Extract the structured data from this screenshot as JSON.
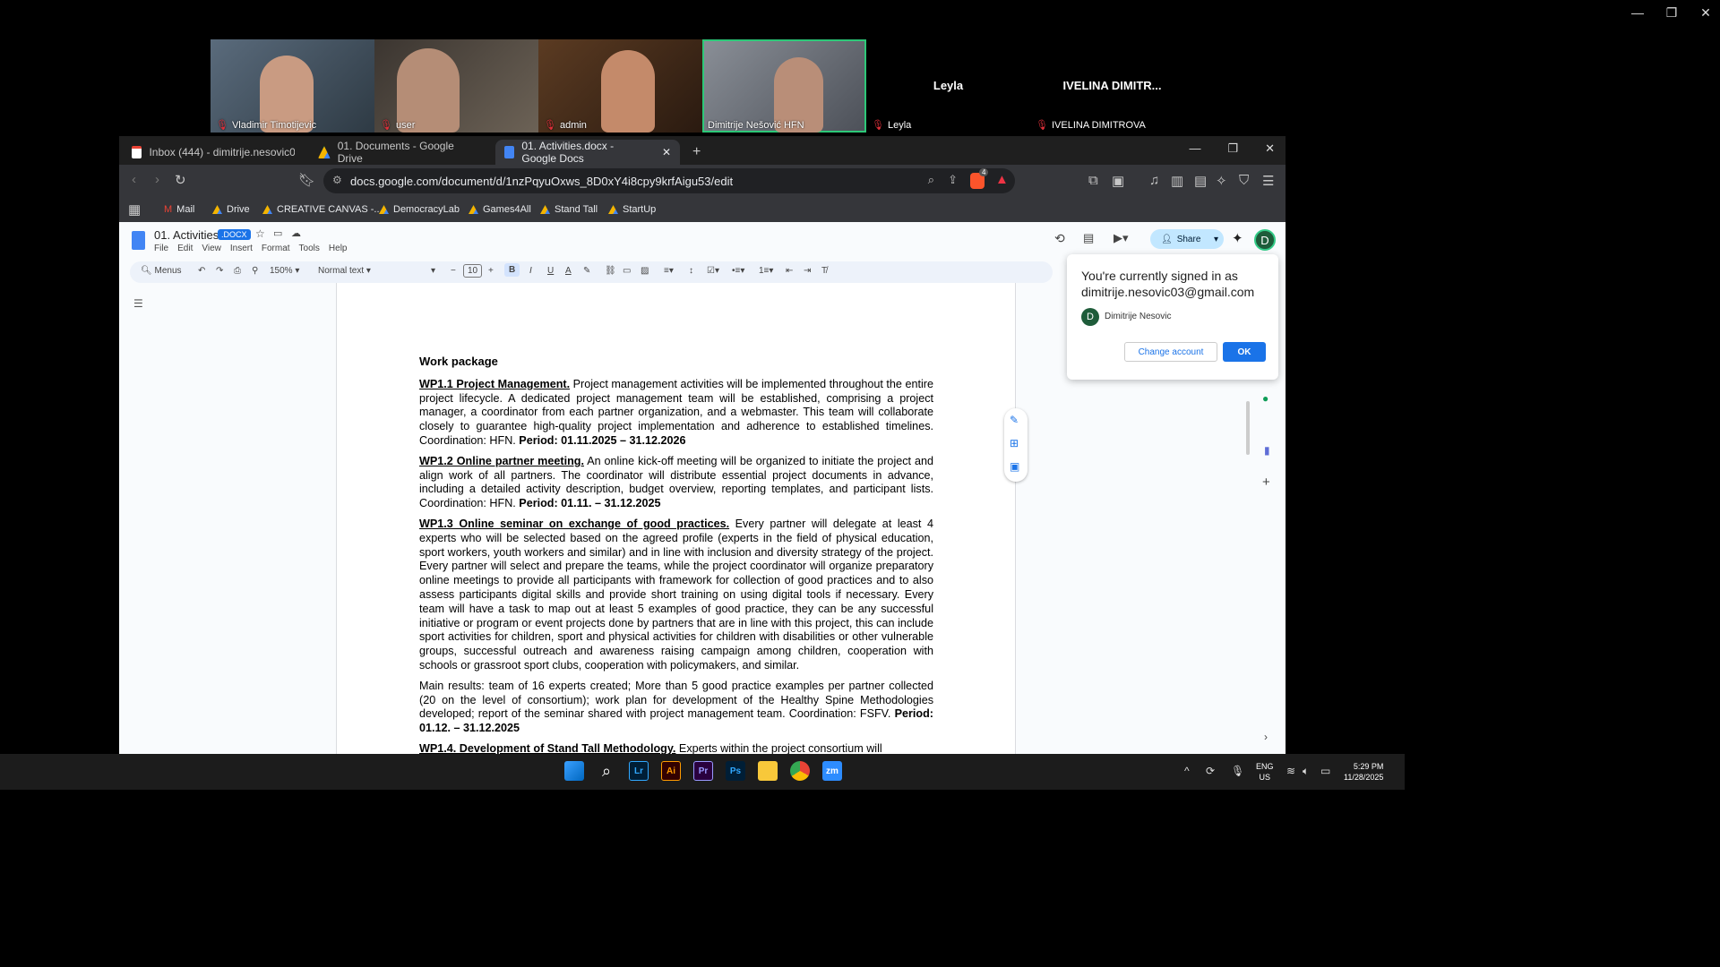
{
  "zoom_window": {
    "minimize": "—",
    "restore": "❐",
    "close": "✕"
  },
  "participants": [
    {
      "name": "Vladimir Timotijevic",
      "muted": true
    },
    {
      "name": "user",
      "muted": true
    },
    {
      "name": "admin",
      "muted": true
    },
    {
      "name": "Dimitrije Nešović HFN",
      "muted": false,
      "active": true
    },
    {
      "name": "Leyla",
      "muted": true,
      "center_name": "Leyla"
    },
    {
      "name": "IVELINA DIMITROVA",
      "muted": true,
      "center_name": "IVELINA DIMITR..."
    }
  ],
  "browser": {
    "tabs": [
      {
        "label": "Inbox (444) - dimitrije.nesovic03@gm",
        "icon": "gmail-icon"
      },
      {
        "label": "01. Documents - Google Drive",
        "icon": "drive-icon"
      },
      {
        "label": "01. Activities.docx - Google Docs",
        "icon": "docs-icon",
        "active": true
      }
    ],
    "url": "docs.google.com/document/d/1nzPqyuOxws_8D0xY4i8cpy9krfAigu53/edit",
    "bookmarks": [
      "Mail",
      "Drive",
      "CREATIVE CANVAS -...",
      "DemocracyLab",
      "Games4All",
      "Stand Tall",
      "StartUp"
    ],
    "shields_count": "4"
  },
  "docs": {
    "title": "01. Activities",
    "badge": ".DOCX",
    "menu": [
      "File",
      "Edit",
      "View",
      "Insert",
      "Format",
      "Tools",
      "Help"
    ],
    "search_menus": "Menus",
    "zoom": "150%",
    "style": "Normal text",
    "font_size": "10",
    "share_label": "Share",
    "avatar_letter": "D"
  },
  "document": {
    "heading": "Work package",
    "p1_title": "WP1.1 Project Management.",
    "p1_text": " Project management activities will be implemented throughout the entire project lifecycle. A dedicated project management team will be established, comprising a project manager, a coordinator from each partner organization, and a webmaster. This team will collaborate closely to guarantee high-quality project implementation and adherence to established timelines. Coordination: HFN. ",
    "p1_period": "Period: 01.11.2025 – 31.12.2026",
    "p2_title": "WP1.2 Online partner meeting.",
    "p2_text": " An online kick-off meeting will be organized to initiate the project and align work of all partners. The coordinator will distribute essential project documents in advance, including a detailed activity description, budget overview, reporting templates, and participant lists. Coordination: HFN. ",
    "p2_period": "Period: 01.11. – 31.12.2025",
    "p3_title": "WP1.3 Online seminar on exchange of good practices.",
    "p3_text": " Every partner will delegate at least 4 experts who will be selected based on the agreed profile (experts in the field of physical education, sport workers, youth workers and similar) and in line with inclusion and diversity strategy of the project. Every partner will select and prepare the teams, while the project coordinator will organize preparatory online meetings to provide all participants with framework for collection of good practices and to also assess participants digital skills and provide short training on using digital tools if necessary. Every team will have a task to map out at least 5 examples of good practice, they can be any successful initiative or program or event projects done by partners that are in line with this project, this can include sport activities for children, sport and physical activities for children with disabilities or other vulnerable groups, successful outreach and awareness raising campaign among children, cooperation with schools or grassroot sport clubs, cooperation with policymakers, and similar.",
    "p4_text": "Main results: team of 16 experts created; More than 5 good practice examples per partner collected (20 on the level of consortium); work plan for development of the Healthy Spine Methodologies developed; report of the seminar shared with project management team. Coordination: FSFV. ",
    "p4_period": "Period: 01.12. – 31.12.2025",
    "p5_title": "WP1.4. Development of Stand Tall Methodology.",
    "p5_text": " Experts within the project consortium will"
  },
  "signin_popup": {
    "line1": "You're currently signed in as",
    "email": "dimitrije.nesovic03@gmail.com",
    "account_name": "Dimitrije Nesovic",
    "avatar_letter": "D",
    "change_label": "Change account",
    "ok_label": "OK"
  },
  "taskbar": {
    "lang": "ENG",
    "region": "US",
    "time": "5:29 PM",
    "date": "11/28/2025",
    "apps": [
      "Lr",
      "Ai",
      "Pr",
      "Ps"
    ]
  }
}
